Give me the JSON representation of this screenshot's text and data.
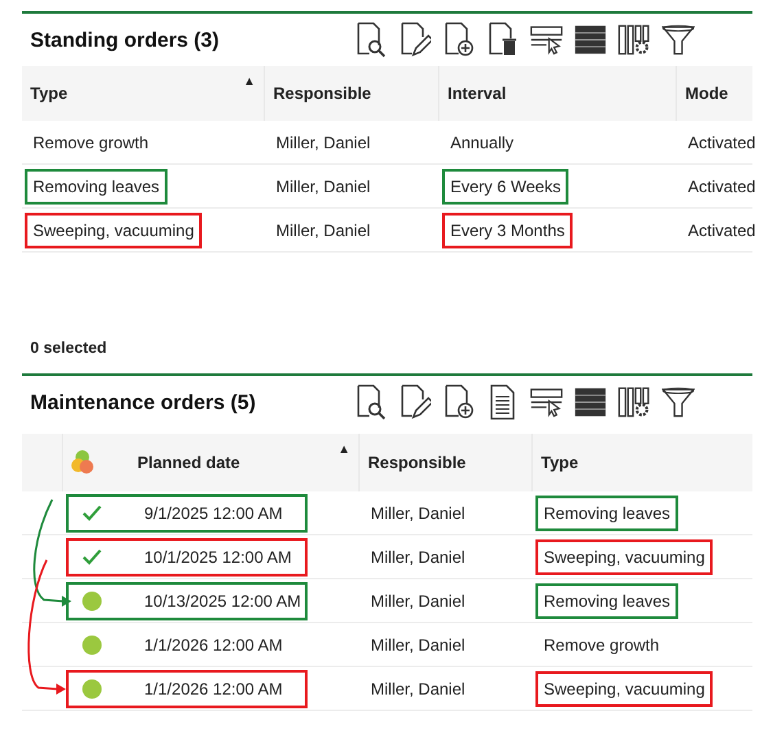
{
  "standing_orders": {
    "title": "Standing orders (3)",
    "toolbar": [
      {
        "kind": "view"
      },
      {
        "kind": "edit"
      },
      {
        "kind": "add"
      },
      {
        "kind": "delete"
      },
      {
        "kind": "select"
      },
      {
        "kind": "rows"
      },
      {
        "kind": "columns"
      },
      {
        "kind": "filter"
      }
    ],
    "columns": [
      {
        "label": "Type",
        "sort_indicator": "▲"
      },
      {
        "label": "Responsible"
      },
      {
        "label": "Interval"
      },
      {
        "label": "Mode"
      }
    ],
    "rows": [
      {
        "type": "Remove growth",
        "responsible": "Miller, Daniel",
        "interval": "Annually",
        "mode": "Activated"
      },
      {
        "type": "Removing leaves",
        "responsible": "Miller, Daniel",
        "interval": "Every 6 Weeks",
        "mode": "Activated",
        "color": "#1e8a3c"
      },
      {
        "type": "Sweeping, vacuuming",
        "responsible": "Miller, Daniel",
        "interval": "Every 3 Months",
        "mode": "Activated",
        "color": "#e8191e"
      }
    ]
  },
  "selection_status": "0 selected",
  "maintenance_orders": {
    "title": "Maintenance orders (5)",
    "toolbar": [
      {
        "kind": "view"
      },
      {
        "kind": "edit"
      },
      {
        "kind": "add"
      },
      {
        "kind": "document"
      },
      {
        "kind": "select"
      },
      {
        "kind": "rows"
      },
      {
        "kind": "columns"
      },
      {
        "kind": "filter"
      }
    ],
    "columns": [
      {
        "label": "Planned date",
        "sort_indicator": "▲"
      },
      {
        "label": "Responsible"
      },
      {
        "label": "Type"
      }
    ],
    "rows": [
      {
        "kind": "done",
        "planned_date": "9/1/2025 12:00 AM",
        "responsible": "Miller, Daniel",
        "type": "Removing leaves",
        "color": "#1e8a3c"
      },
      {
        "kind": "done",
        "planned_date": "10/1/2025 12:00 AM",
        "responsible": "Miller, Daniel",
        "type": "Sweeping, vacuuming",
        "color": "#e8191e"
      },
      {
        "kind": "planned",
        "planned_date": "10/13/2025 12:00 AM",
        "responsible": "Miller, Daniel",
        "type": "Removing leaves",
        "color": "#1e8a3c"
      },
      {
        "kind": "planned",
        "planned_date": "1/1/2026 12:00 AM",
        "responsible": "Miller, Daniel",
        "type": "Remove growth"
      },
      {
        "kind": "planned",
        "planned_date": "1/1/2026 12:00 AM",
        "responsible": "Miller, Daniel",
        "type": "Sweeping, vacuuming",
        "color": "#e8191e"
      }
    ]
  }
}
